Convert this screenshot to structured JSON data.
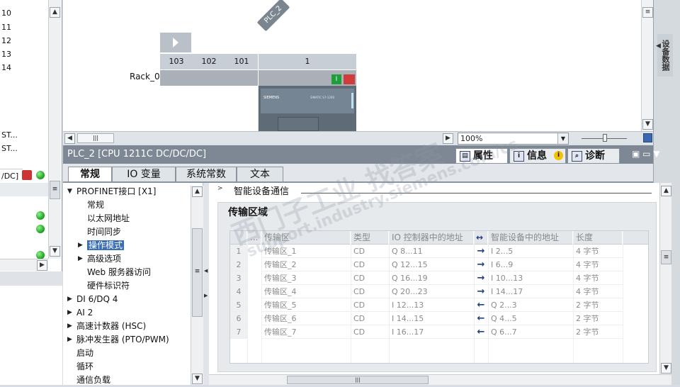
{
  "left_list": {
    "rows": [
      "10",
      "11",
      "12",
      "13",
      "14",
      "ST...",
      "ST...",
      "/DC]"
    ]
  },
  "device_view": {
    "plc_tag": "PLC_2",
    "rack_label": "Rack_0",
    "slots": [
      "103",
      "102",
      "101",
      "1"
    ],
    "cpu_brand": "SIEMENS",
    "cpu_model": "SIMATIC S7-1200",
    "zoom": "100%",
    "side_tab": "设备数据"
  },
  "inspector": {
    "title": "PLC_2 [CPU 1211C DC/DC/DC]",
    "tabs": [
      {
        "label": "属性",
        "icon": "properties-icon"
      },
      {
        "label": "信息",
        "icon": "info-icon"
      },
      {
        "label": "诊断",
        "icon": "diagnostics-icon"
      }
    ],
    "property_tabs": [
      "常规",
      "IO 变量",
      "系统常数",
      "文本"
    ],
    "nav": [
      {
        "label": "PROFINET接口 [X1]",
        "level": 0,
        "expander": "▼"
      },
      {
        "label": "常规",
        "level": 1,
        "expander": ""
      },
      {
        "label": "以太网地址",
        "level": 1,
        "expander": ""
      },
      {
        "label": "时间同步",
        "level": 1,
        "expander": ""
      },
      {
        "label": "操作模式",
        "level": 1,
        "expander": "▶"
      },
      {
        "label": "高级选项",
        "level": 1,
        "expander": "▶"
      },
      {
        "label": "Web 服务器访问",
        "level": 1,
        "expander": ""
      },
      {
        "label": "硬件标识符",
        "level": 1,
        "expander": ""
      },
      {
        "label": "DI 6/DQ 4",
        "level": 0,
        "expander": "▶"
      },
      {
        "label": "AI 2",
        "level": 0,
        "expander": "▶"
      },
      {
        "label": "高速计数器 (HSC)",
        "level": 0,
        "expander": "▶"
      },
      {
        "label": "脉冲发生器 (PTO/PWM)",
        "level": 0,
        "expander": "▶"
      },
      {
        "label": "启动",
        "level": 0,
        "expander": ""
      },
      {
        "label": "循环",
        "level": 0,
        "expander": ""
      },
      {
        "label": "通信负载",
        "level": 0,
        "expander": ""
      }
    ],
    "section_header": "智能设备通信",
    "group_title": "传输区域",
    "table": {
      "columns": [
        "...",
        "传输区",
        "类型",
        "IO 控制器中的地址",
        "↔",
        "智能设备中的地址",
        "长度"
      ],
      "rows": [
        [
          "1",
          "传输区_1",
          "CD",
          "Q 8...11",
          "→",
          "I 2...5",
          "4 字节"
        ],
        [
          "2",
          "传输区_2",
          "CD",
          "Q 12...15",
          "→",
          "I 6...9",
          "4 字节"
        ],
        [
          "3",
          "传输区_3",
          "CD",
          "Q 16...19",
          "→",
          "I 10...13",
          "4 字节"
        ],
        [
          "4",
          "传输区_4",
          "CD",
          "Q 20...23",
          "→",
          "I 14...17",
          "4 字节"
        ],
        [
          "5",
          "传输区_5",
          "CD",
          "I 12...13",
          "←",
          "Q 2...3",
          "2 字节"
        ],
        [
          "6",
          "传输区_6",
          "CD",
          "I 14...15",
          "←",
          "Q 4...5",
          "2 字节"
        ],
        [
          "7",
          "传输区_7",
          "CD",
          "I 16...17",
          "←",
          "Q 6...7",
          "2 字节"
        ]
      ]
    }
  },
  "watermark": {
    "line1": "西门子工业   找答案",
    "line2": "support.industry.siemens.com/cs"
  },
  "colors": {
    "title_bar": "#7d8894",
    "selection": "#3a6fb8",
    "status_green": "#1a9c1a",
    "arrow": "#203c80"
  }
}
